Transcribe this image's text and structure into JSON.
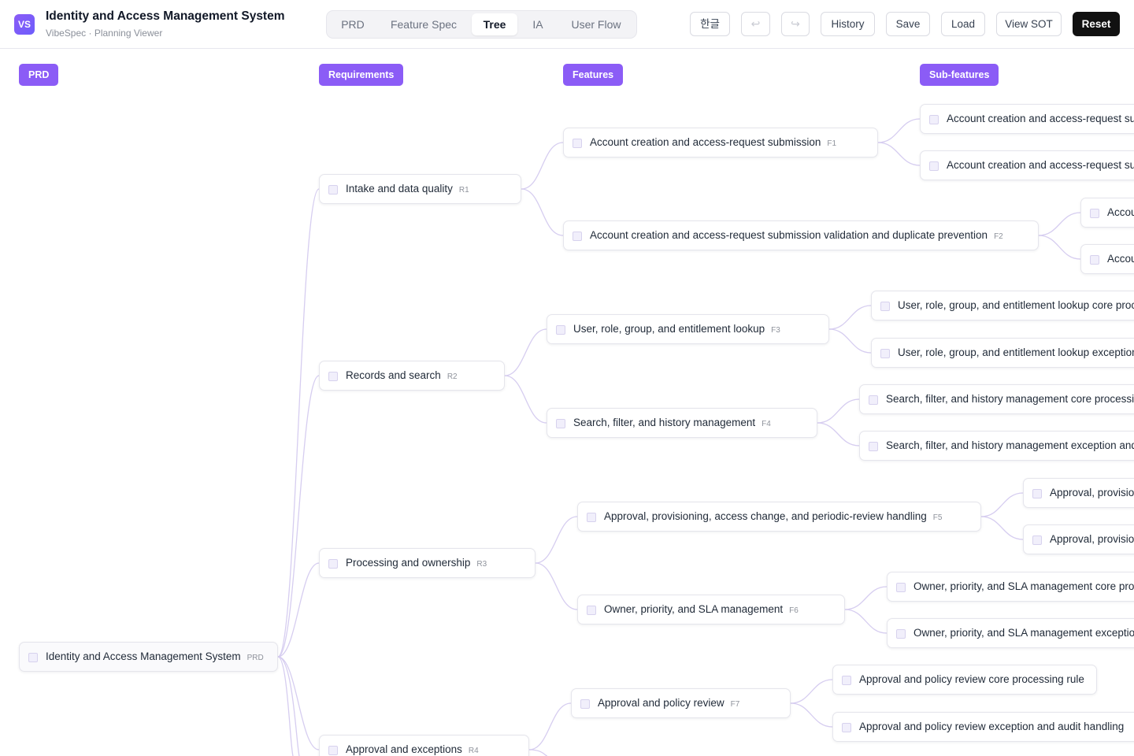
{
  "app": {
    "logo": "VS",
    "title": "Identity and Access Management System",
    "subtitle": "VibeSpec · Planning Viewer"
  },
  "tabs": [
    {
      "label": "PRD",
      "active": false
    },
    {
      "label": "Feature Spec",
      "active": false
    },
    {
      "label": "Tree",
      "active": true
    },
    {
      "label": "IA",
      "active": false
    },
    {
      "label": "User Flow",
      "active": false
    }
  ],
  "toolbar": {
    "language": "한글",
    "undo_icon": "undo-icon",
    "redo_icon": "redo-icon",
    "history": "History",
    "save": "Save",
    "load": "Load",
    "view_sot": "View SOT",
    "reset": "Reset"
  },
  "colors": {
    "accent": "#8b5cf6",
    "link": "#d6cdf0",
    "reset_button": "#111111"
  },
  "columns": [
    "PRD",
    "Requirements",
    "Features",
    "Sub-features"
  ],
  "tree": {
    "root": {
      "label": "Identity and Access Management System",
      "tag": "PRD"
    },
    "requirements": [
      {
        "label": "Intake and data quality",
        "tag": "R1"
      },
      {
        "label": "Records and search",
        "tag": "R2"
      },
      {
        "label": "Processing and ownership",
        "tag": "R3"
      },
      {
        "label": "Approval and exceptions",
        "tag": "R4"
      }
    ],
    "features": [
      {
        "label": "Account creation and access-request submission",
        "tag": "F1"
      },
      {
        "label": "Account creation and access-request submission validation and duplicate prevention",
        "tag": "F2"
      },
      {
        "label": "User, role, group, and entitlement lookup",
        "tag": "F3"
      },
      {
        "label": "Search, filter, and history management",
        "tag": "F4"
      },
      {
        "label": "Approval, provisioning, access change, and periodic-review handling",
        "tag": "F5"
      },
      {
        "label": "Owner, priority, and SLA management",
        "tag": "F6"
      },
      {
        "label": "Approval and policy review",
        "tag": "F7"
      }
    ],
    "subfeatures": [
      {
        "label": "Account creation and access-request subm"
      },
      {
        "label": "Account creation and access-request subm"
      },
      {
        "label": "Accou"
      },
      {
        "label": "Accou"
      },
      {
        "label": "User, role, group, and entitlement lookup core proces"
      },
      {
        "label": "User, role, group, and entitlement lookup exception a"
      },
      {
        "label": "Search, filter, and history management core processing"
      },
      {
        "label": "Search, filter, and history management exception and au"
      },
      {
        "label": "Approval, provisior"
      },
      {
        "label": "Approval, provisior"
      },
      {
        "label": "Owner, priority, and SLA management core proce"
      },
      {
        "label": "Owner, priority, and SLA management exception a"
      },
      {
        "label": "Approval and policy review core processing rule"
      },
      {
        "label": "Approval and policy review exception and audit handling"
      }
    ]
  }
}
